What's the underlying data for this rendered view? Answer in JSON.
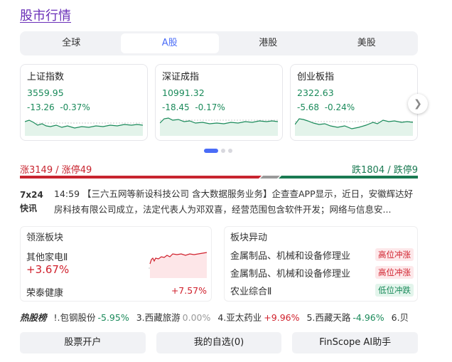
{
  "title": "股市行情",
  "tabs": [
    "全球",
    "A股",
    "港股",
    "美股"
  ],
  "active_tab": "A股",
  "indices": [
    {
      "name": "上证指数",
      "value": "3559.95",
      "change": "-13.26",
      "pct": "-0.37%"
    },
    {
      "name": "深证成指",
      "value": "10991.32",
      "change": "-18.45",
      "pct": "-0.17%"
    },
    {
      "name": "创业板指",
      "value": "2322.63",
      "change": "-5.68",
      "pct": "-0.24%"
    }
  ],
  "next_icon": "chevron-right-icon",
  "breadth": {
    "up_text": "涨3149 / 涨停49",
    "down_text": "跌1804 / 跌停9",
    "up_count": 3149,
    "down_count": 1804
  },
  "news": {
    "badge_line1": "7x24",
    "badge_line2": "快讯",
    "time": "14:59",
    "text": "【三六五网等新设科技公司 含大数据服务业务】企查查APP显示，近日，安徽辉达好房科技有限公司成立，法定代表人为邓双喜，经营范围包含软件开发；网络与信息安..."
  },
  "leading_sector": {
    "header": "领涨板块",
    "name": "其他家电Ⅱ",
    "pct": "+3.67%",
    "stock": "荣泰健康",
    "stock_pct": "+7.57%"
  },
  "sector_moves": {
    "header": "板块异动",
    "rows": [
      {
        "name": "金属制品、机械和设备修理业",
        "tag": "高位冲涨",
        "kind": "hi"
      },
      {
        "name": "金属制品、机械和设备修理业",
        "tag": "高位冲涨",
        "kind": "hi"
      },
      {
        "name": "农业综合Ⅱ",
        "tag": "低位冲跌",
        "kind": "lo"
      }
    ]
  },
  "hot": {
    "label": "热股榜",
    "items": [
      {
        "name": "!.包钢股份",
        "pct": "-5.95%",
        "dir": "dn"
      },
      {
        "name": "3.西藏旅游",
        "pct": "0.00%",
        "dir": "fl"
      },
      {
        "name": "4.亚太药业",
        "pct": "+9.96%",
        "dir": "up"
      },
      {
        "name": "5.西藏天路",
        "pct": "-4.96%",
        "dir": "dn"
      },
      {
        "name": "6.贝",
        "pct": "",
        "dir": "fl"
      }
    ]
  },
  "buttons": [
    "股票开户",
    "我的自选(0)",
    "FinScope AI助手"
  ],
  "colors": {
    "up": "#d0202c",
    "down": "#1a8a5a",
    "accent": "#4a6cf7",
    "title": "#6a2fb8"
  }
}
